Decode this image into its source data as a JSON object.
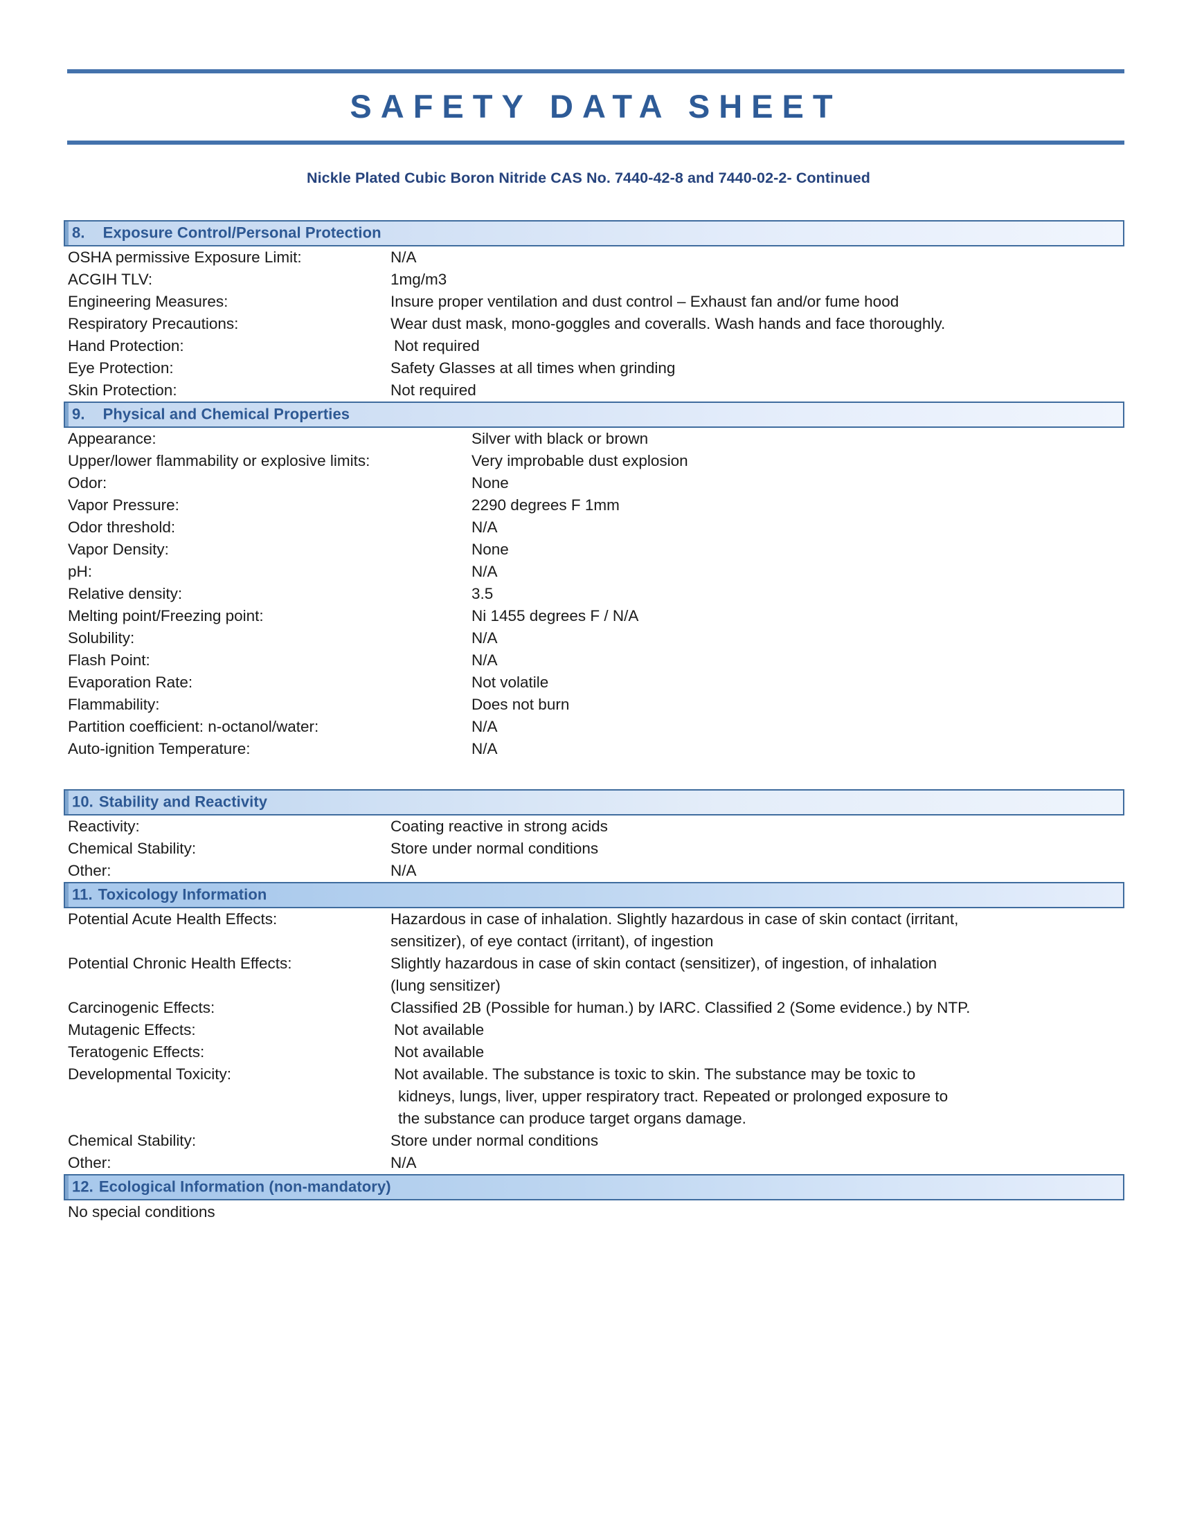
{
  "document": {
    "title": "SAFETY DATA SHEET",
    "subtitle": "Nickle Plated Cubic Boron Nitride CAS No. 7440-42-8 and 7440-02-2- Continued",
    "accent_color": "#4472ac",
    "title_color": "#2e5b97",
    "subtitle_color": "#26437d",
    "section_border_color": "#3f6c9e"
  },
  "sections": {
    "s8": {
      "number": "8.",
      "title": "Exposure Control/Personal Protection",
      "rows": [
        {
          "label": "OSHA permissive Exposure Limit:",
          "value": "N/A"
        },
        {
          "label": "ACGIH TLV:",
          "value": "1mg/m3"
        },
        {
          "label": "Engineering Measures:",
          "value": "Insure proper ventilation and dust control – Exhaust fan and/or fume hood"
        },
        {
          "label": "Respiratory Precautions:",
          "value": "Wear dust mask, mono-goggles and coveralls. Wash hands and face thoroughly."
        },
        {
          "label": "Hand Protection:",
          "value": "Not required"
        },
        {
          "label": "Eye Protection:",
          "value": "Safety Glasses at all times when grinding"
        },
        {
          "label": "Skin Protection:",
          "value": "Not required"
        }
      ]
    },
    "s9": {
      "number": "9.",
      "title": "Physical and Chemical Properties",
      "rows": [
        {
          "label": "Appearance:",
          "value": "Silver with black or brown"
        },
        {
          "label": "Upper/lower flammability or explosive limits:",
          "value": "Very improbable dust explosion"
        },
        {
          "label": "Odor:",
          "value": "None"
        },
        {
          "label": "Vapor Pressure:",
          "value": "2290 degrees F 1mm"
        },
        {
          "label": "Odor threshold:",
          "value": "N/A"
        },
        {
          "label": "Vapor Density:",
          "value": "None"
        },
        {
          "label": "pH:",
          "value": "N/A"
        },
        {
          "label": "Relative density:",
          "value": "3.5"
        },
        {
          "label": "Melting point/Freezing point:",
          "value": "Ni 1455 degrees F / N/A"
        },
        {
          "label": "Solubility:",
          "value": "N/A"
        },
        {
          "label": "Flash Point:",
          "value": "N/A"
        },
        {
          "label": "Evaporation Rate:",
          "value": "Not volatile"
        },
        {
          "label": "Flammability:",
          "value": "Does not burn"
        },
        {
          "label": "Partition coefficient: n-octanol/water:",
          "value": "N/A"
        },
        {
          "label": "Auto-ignition Temperature:",
          "value": "N/A"
        }
      ]
    },
    "s10": {
      "number": "10.",
      "title": "Stability and Reactivity",
      "rows": [
        {
          "label": "Reactivity:",
          "value": "Coating reactive in strong acids"
        },
        {
          "label": "Chemical Stability:",
          "value": "Store under normal conditions"
        },
        {
          "label": "Other:",
          "value": "N/A"
        }
      ]
    },
    "s11": {
      "number": "11.",
      "title": "Toxicology Information",
      "rows": [
        {
          "label": "Potential Acute Health Effects:",
          "lines": [
            "Hazardous in case of inhalation. Slightly hazardous in case of skin contact (irritant,",
            "sensitizer), of eye contact (irritant), of ingestion"
          ]
        },
        {
          "label": "Potential Chronic Health Effects:",
          "lines": [
            "Slightly hazardous in case of skin contact (sensitizer), of ingestion, of inhalation",
            "(lung sensitizer)"
          ]
        },
        {
          "label": "Carcinogenic Effects:",
          "lines": [
            "Classified 2B (Possible for human.) by IARC. Classified 2 (Some evidence.) by NTP."
          ]
        },
        {
          "label": "Mutagenic Effects:",
          "lines": [
            "Not available"
          ]
        },
        {
          "label": "Teratogenic Effects:",
          "lines": [
            "Not available"
          ]
        },
        {
          "label": "Developmental Toxicity:",
          "lines": [
            "Not available. The substance is toxic to skin. The substance may be toxic to",
            "kidneys, lungs, liver, upper respiratory tract. Repeated or prolonged exposure to",
            "the substance can produce target organs damage."
          ]
        },
        {
          "label": "Chemical Stability:",
          "lines": [
            "Store under normal conditions"
          ]
        },
        {
          "label": "Other:",
          "lines": [
            "N/A"
          ]
        }
      ]
    },
    "s12": {
      "number": "12.",
      "title": "Ecological Information (non-mandatory)",
      "body": "No special conditions"
    }
  }
}
